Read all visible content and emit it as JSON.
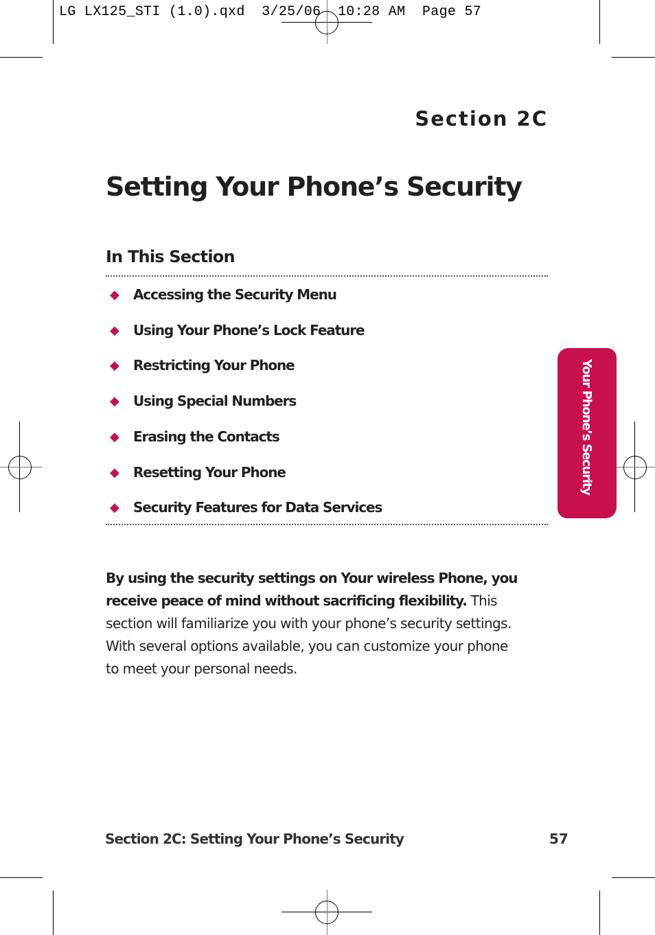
{
  "slug_line": "LG LX125_STI (1.0).qxd  3/25/06  10:28 AM  Page 57",
  "section_label": "Section 2C",
  "title": "Setting Your Phone’s Security",
  "in_this_section": {
    "heading": "In This Section",
    "items": [
      {
        "label": "Accessing the Security Menu"
      },
      {
        "label": "Using Your Phone’s Lock Feature"
      },
      {
        "label": "Restricting Your Phone"
      },
      {
        "label": "Using Special Numbers"
      },
      {
        "label": "Erasing the Contacts"
      },
      {
        "label": "Resetting Your Phone"
      },
      {
        "label": "Security Features for Data Services"
      }
    ],
    "bullet_icon": "diamond-icon",
    "bullet_color": "#c8104f"
  },
  "intro": {
    "bold": "By using the security settings on Your wireless Phone, you receive peace of mind without sacrificing flexibility.",
    "regular": " This section will familiarize you with your phone’s security settings. With several options available, you can customize your phone to meet your personal needs."
  },
  "side_tab": {
    "label": "Your Phone’s Security",
    "color": "#c8104f"
  },
  "footer": {
    "left": "Section 2C: Setting Your Phone’s Security",
    "page_number": "57"
  }
}
